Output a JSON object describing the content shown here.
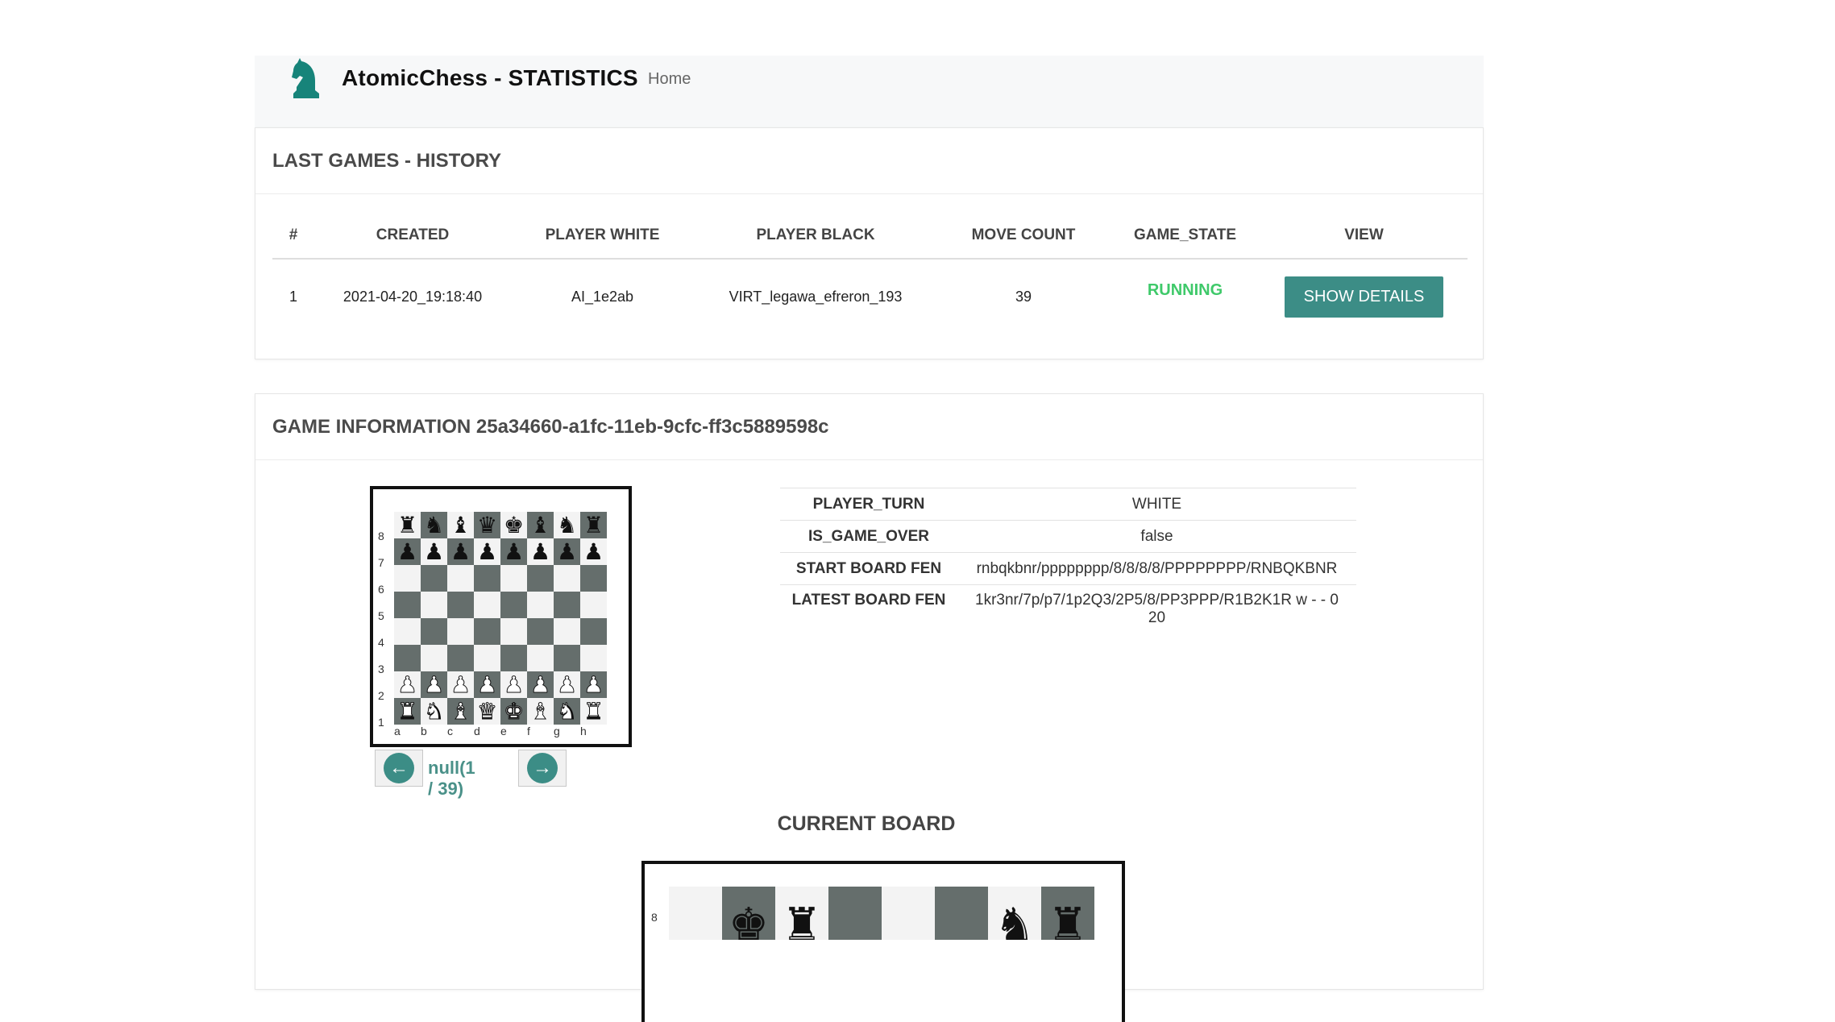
{
  "nav": {
    "brand": "AtomicChess - STATISTICS",
    "home": "Home",
    "logo_icon": "knight-icon"
  },
  "history": {
    "title": "LAST GAMES - HISTORY",
    "columns": [
      "#",
      "CREATED",
      "PLAYER WHITE",
      "PLAYER BLACK",
      "MOVE COUNT",
      "GAME_STATE",
      "VIEW"
    ],
    "rows": [
      {
        "num": "1",
        "created": "2021-04-20_19:18:40",
        "white": "AI_1e2ab",
        "black": "VIRT_legawa_efreron_193",
        "moves": "39",
        "state": "RUNNING",
        "view": "SHOW DETAILS"
      }
    ]
  },
  "game": {
    "title": "GAME INFORMATION 25a34660-a1fc-11eb-9cfc-ff3c5889598c",
    "board_start": [
      "rnbqkbnr",
      "pppppppp",
      "........",
      "........",
      "........",
      "........",
      "PPPPPPPP",
      "RNBQKBNR"
    ],
    "ranks": [
      "8",
      "7",
      "6",
      "5",
      "4",
      "3",
      "2",
      "1"
    ],
    "files": [
      "a",
      "b",
      "c",
      "d",
      "e",
      "f",
      "g",
      "h"
    ],
    "pager": {
      "label": "null(1 / 39)",
      "prev_icon": "arrow-left-icon",
      "next_icon": "arrow-right-icon"
    },
    "info": [
      {
        "key": "PLAYER_TURN",
        "value": "WHITE"
      },
      {
        "key": "IS_GAME_OVER",
        "value": "false"
      },
      {
        "key": "START BOARD FEN",
        "value": "rnbqkbnr/pppppppp/8/8/8/8/PPPPPPPP/RNBQKBNR"
      },
      {
        "key": "LATEST BOARD FEN",
        "value": "1kr3nr/7p/p7/1p2Q3/2P5/8/PP3PPP/R1B2K1R w - - 0 20"
      }
    ],
    "current_title": "CURRENT BOARD",
    "current_top_rank": ". k r . . . n r",
    "current_rank_label": "8"
  },
  "colors": {
    "accent": "#3c8d86",
    "link": "#4a9189",
    "running": "#3fc96a",
    "dark_square": "#656e6c"
  }
}
